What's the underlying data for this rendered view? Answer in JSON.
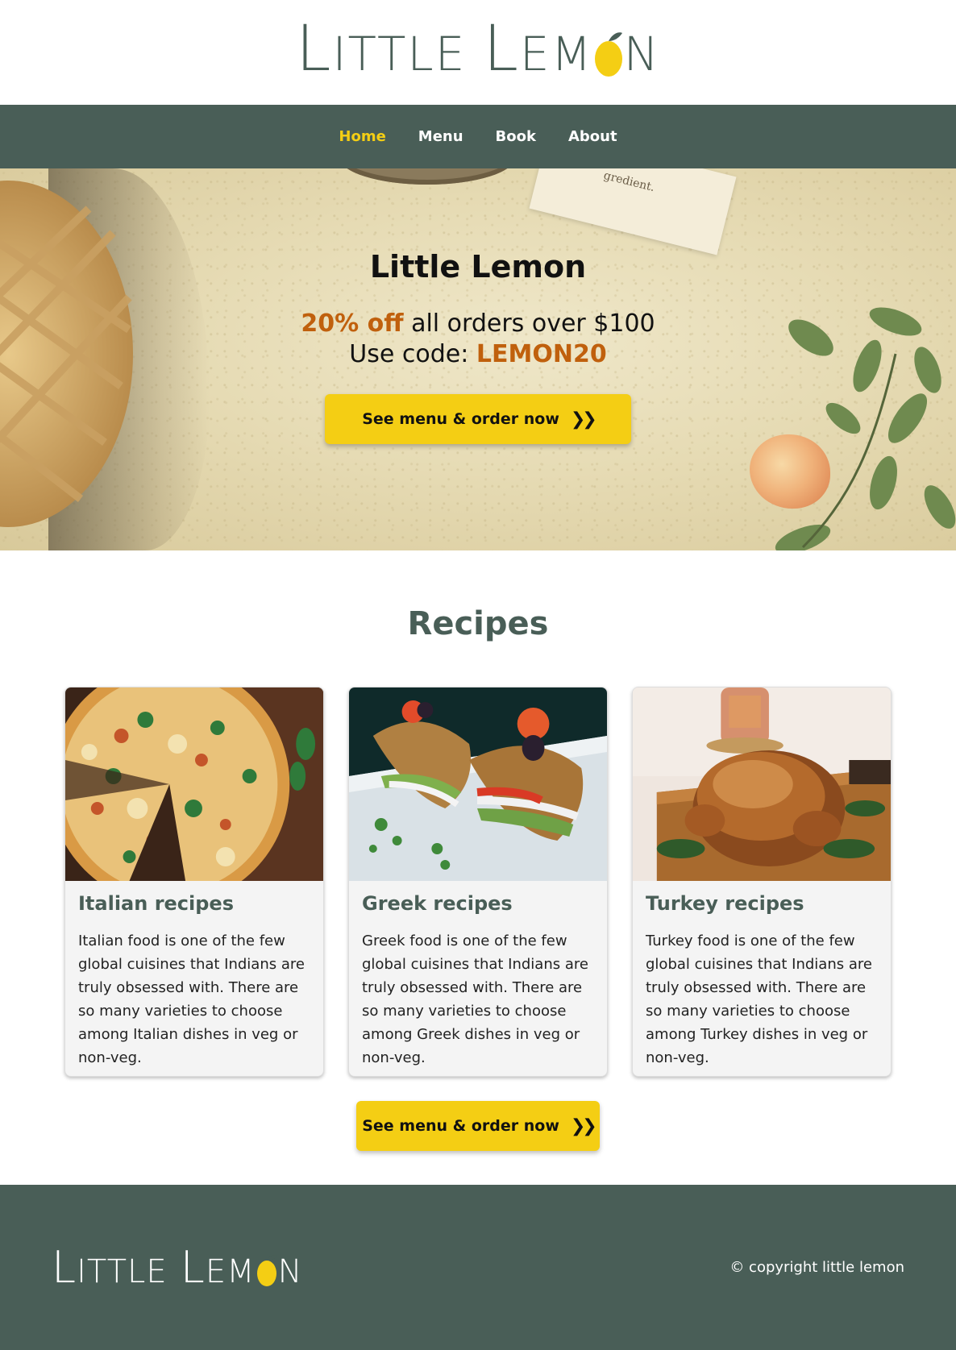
{
  "brand": {
    "name_part1": "Little",
    "name_part2": "Lemon",
    "logo_color": "#495e57",
    "accent_color": "#f4ce14",
    "promo_color": "#c0600d"
  },
  "nav": {
    "items": [
      {
        "label": "Home",
        "active": true
      },
      {
        "label": "Menu",
        "active": false
      },
      {
        "label": "Book",
        "active": false
      },
      {
        "label": "About",
        "active": false
      }
    ]
  },
  "hero": {
    "title": "Little Lemon",
    "promo_discount": "20% off",
    "promo_rest": " all orders over $100",
    "code_prefix": "Use code: ",
    "code": "LEMON20",
    "cta_label": "See menu & order now",
    "cta_icon": "double-chevron-right-icon",
    "paper_text": "gredient."
  },
  "recipes": {
    "title": "Recipes",
    "cards": [
      {
        "title": "Italian recipes",
        "text": "Italian food is one of the few global cuisines that Indians are truly obsessed with. There are so many varieties to choose among Italian dishes in veg or non-veg.",
        "image": "pizza-image"
      },
      {
        "title": "Greek recipes",
        "text": "Greek food is one of the few global cuisines that Indians are truly obsessed with. There are so many varieties to choose among Greek dishes in veg or non-veg.",
        "image": "greek-bagel-image"
      },
      {
        "title": "Turkey recipes",
        "text": "Turkey food is one of the few global cuisines that Indians are truly obsessed with. There are so many varieties to choose among Turkey dishes in veg or non-veg.",
        "image": "roast-turkey-image"
      }
    ],
    "cta_label": "See menu & order now"
  },
  "footer": {
    "copyright": "© copyright little lemon"
  }
}
